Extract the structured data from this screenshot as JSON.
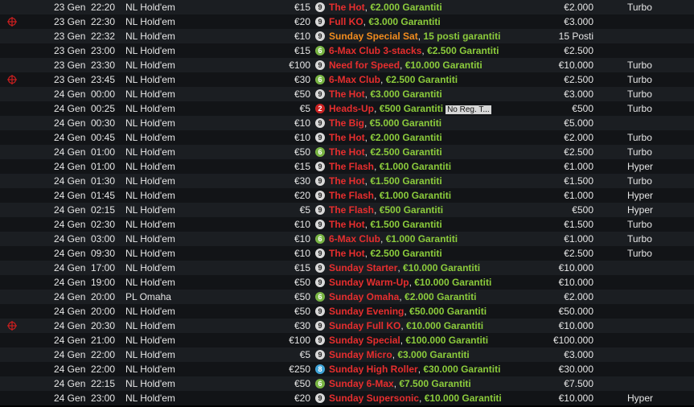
{
  "colors": {
    "title_red": "#e62e2e",
    "title_orange": "#f28c1e",
    "guarantee_green": "#8ccc3c",
    "row_odd": "#1b1e22",
    "row_even": "#121417",
    "mark_red": "#cc1f1f"
  },
  "rows": [
    {
      "mark": false,
      "date": "23 Gen",
      "time": "22:20",
      "game": "NL Hold'em",
      "buyin": "€15",
      "seats": "9",
      "title": "The Hot",
      "title_color": "red",
      "guarantee": "€2.000 Garantiti",
      "prize": "€2.000",
      "type": "Turbo"
    },
    {
      "mark": true,
      "date": "23 Gen",
      "time": "22:30",
      "game": "NL Hold'em",
      "buyin": "€20",
      "seats": "9",
      "title": "Full KO",
      "title_color": "red",
      "guarantee": "€3.000 Garantiti",
      "prize": "€3.000",
      "type": ""
    },
    {
      "mark": false,
      "date": "23 Gen",
      "time": "22:32",
      "game": "NL Hold'em",
      "buyin": "€10",
      "seats": "9",
      "title": "Sunday Special Sat",
      "title_color": "orange",
      "guarantee": "15 posti garantiti",
      "prize": "15 Posti",
      "type": ""
    },
    {
      "mark": false,
      "date": "23 Gen",
      "time": "23:00",
      "game": "NL Hold'em",
      "buyin": "€15",
      "seats": "6",
      "title": "6-Max Club 3-stacks",
      "title_color": "red",
      "guarantee": "€2.500 Garantiti",
      "prize": "€2.500",
      "type": ""
    },
    {
      "mark": false,
      "date": "23 Gen",
      "time": "23:30",
      "game": "NL Hold'em",
      "buyin": "€100",
      "seats": "9",
      "title": "Need for Speed",
      "title_color": "red",
      "guarantee": "€10.000 Garantiti",
      "prize": "€10.000",
      "type": "Turbo"
    },
    {
      "mark": true,
      "date": "23 Gen",
      "time": "23:45",
      "game": "NL Hold'em",
      "buyin": "€30",
      "seats": "6",
      "title": "6-Max Club",
      "title_color": "red",
      "guarantee": "€2.500 Garantiti",
      "prize": "€2.500",
      "type": "Turbo"
    },
    {
      "mark": false,
      "date": "24 Gen",
      "time": "00:00",
      "game": "NL Hold'em",
      "buyin": "€50",
      "seats": "9",
      "title": "The Hot",
      "title_color": "red",
      "guarantee": "€3.000 Garantiti",
      "prize": "€3.000",
      "type": "Turbo"
    },
    {
      "mark": false,
      "date": "24 Gen",
      "time": "00:25",
      "game": "NL Hold'em",
      "buyin": "€5",
      "seats": "2",
      "title": "Heads-Up",
      "title_color": "red",
      "guarantee": "€500 Garantiti",
      "note": "No Reg. T...",
      "prize": "€500",
      "type": "Turbo"
    },
    {
      "mark": false,
      "date": "24 Gen",
      "time": "00:30",
      "game": "NL Hold'em",
      "buyin": "€10",
      "seats": "9",
      "title": "The Big",
      "title_color": "red",
      "guarantee": "€5.000 Garantiti",
      "prize": "€5.000",
      "type": ""
    },
    {
      "mark": false,
      "date": "24 Gen",
      "time": "00:45",
      "game": "NL Hold'em",
      "buyin": "€10",
      "seats": "9",
      "title": "The Hot",
      "title_color": "red",
      "guarantee": "€2.000 Garantiti",
      "prize": "€2.000",
      "type": "Turbo"
    },
    {
      "mark": false,
      "date": "24 Gen",
      "time": "01:00",
      "game": "NL Hold'em",
      "buyin": "€50",
      "seats": "6",
      "title": "The Hot",
      "title_color": "red",
      "guarantee": "€2.500 Garantiti",
      "prize": "€2.500",
      "type": "Turbo"
    },
    {
      "mark": false,
      "date": "24 Gen",
      "time": "01:00",
      "game": "NL Hold'em",
      "buyin": "€15",
      "seats": "9",
      "title": "The Flash",
      "title_color": "red",
      "guarantee": "€1.000 Garantiti",
      "prize": "€1.000",
      "type": "Hyper"
    },
    {
      "mark": false,
      "date": "24 Gen",
      "time": "01:30",
      "game": "NL Hold'em",
      "buyin": "€30",
      "seats": "9",
      "title": "The Hot",
      "title_color": "red",
      "guarantee": "€1.500 Garantiti",
      "prize": "€1.500",
      "type": "Turbo"
    },
    {
      "mark": false,
      "date": "24 Gen",
      "time": "01:45",
      "game": "NL Hold'em",
      "buyin": "€20",
      "seats": "9",
      "title": "The Flash",
      "title_color": "red",
      "guarantee": "€1.000 Garantiti",
      "prize": "€1.000",
      "type": "Hyper"
    },
    {
      "mark": false,
      "date": "24 Gen",
      "time": "02:15",
      "game": "NL Hold'em",
      "buyin": "€5",
      "seats": "9",
      "title": "The Flash",
      "title_color": "red",
      "guarantee": "€500 Garantiti",
      "prize": "€500",
      "type": "Hyper"
    },
    {
      "mark": false,
      "date": "24 Gen",
      "time": "02:30",
      "game": "NL Hold'em",
      "buyin": "€10",
      "seats": "9",
      "title": "The Hot",
      "title_color": "red",
      "guarantee": "€1.500 Garantiti",
      "prize": "€1.500",
      "type": "Turbo"
    },
    {
      "mark": false,
      "date": "24 Gen",
      "time": "03:00",
      "game": "NL Hold'em",
      "buyin": "€10",
      "seats": "6",
      "title": "6-Max Club",
      "title_color": "red",
      "guarantee": "€1.000 Garantiti",
      "prize": "€1.000",
      "type": "Turbo"
    },
    {
      "mark": false,
      "date": "24 Gen",
      "time": "09:30",
      "game": "NL Hold'em",
      "buyin": "€10",
      "seats": "9",
      "title": "The Hot",
      "title_color": "red",
      "guarantee": "€2.500 Garantiti",
      "prize": "€2.500",
      "type": "Turbo"
    },
    {
      "mark": false,
      "date": "24 Gen",
      "time": "17:00",
      "game": "NL Hold'em",
      "buyin": "€15",
      "seats": "9",
      "title": "Sunday Starter",
      "title_color": "red",
      "guarantee": "€10.000 Garantiti",
      "prize": "€10.000",
      "type": ""
    },
    {
      "mark": false,
      "date": "24 Gen",
      "time": "19:00",
      "game": "NL Hold'em",
      "buyin": "€50",
      "seats": "9",
      "title": "Sunday Warm-Up",
      "title_color": "red",
      "guarantee": "€10.000 Garantiti",
      "prize": "€10.000",
      "type": ""
    },
    {
      "mark": false,
      "date": "24 Gen",
      "time": "20:00",
      "game": "PL Omaha",
      "buyin": "€50",
      "seats": "6",
      "title": "Sunday Omaha",
      "title_color": "red",
      "guarantee": "€2.000 Garantiti",
      "prize": "€2.000",
      "type": ""
    },
    {
      "mark": false,
      "date": "24 Gen",
      "time": "20:00",
      "game": "NL Hold'em",
      "buyin": "€50",
      "seats": "9",
      "title": "Sunday Evening",
      "title_color": "red",
      "guarantee": "€50.000 Garantiti",
      "prize": "€50.000",
      "type": ""
    },
    {
      "mark": true,
      "date": "24 Gen",
      "time": "20:30",
      "game": "NL Hold'em",
      "buyin": "€30",
      "seats": "9",
      "title": "Sunday Full KO",
      "title_color": "red",
      "guarantee": "€10.000 Garantiti",
      "prize": "€10.000",
      "type": ""
    },
    {
      "mark": false,
      "date": "24 Gen",
      "time": "21:00",
      "game": "NL Hold'em",
      "buyin": "€100",
      "seats": "9",
      "title": "Sunday Special",
      "title_color": "red",
      "guarantee": "€100.000 Garantiti",
      "prize": "€100.000",
      "type": ""
    },
    {
      "mark": false,
      "date": "24 Gen",
      "time": "22:00",
      "game": "NL Hold'em",
      "buyin": "€5",
      "seats": "9",
      "title": "Sunday Micro",
      "title_color": "red",
      "guarantee": "€3.000 Garantiti",
      "prize": "€3.000",
      "type": ""
    },
    {
      "mark": false,
      "date": "24 Gen",
      "time": "22:00",
      "game": "NL Hold'em",
      "buyin": "€250",
      "seats": "8",
      "title": "Sunday High Roller",
      "title_color": "red",
      "guarantee": "€30.000 Garantiti",
      "prize": "€30.000",
      "type": ""
    },
    {
      "mark": false,
      "date": "24 Gen",
      "time": "22:15",
      "game": "NL Hold'em",
      "buyin": "€50",
      "seats": "6",
      "title": "Sunday 6-Max",
      "title_color": "red",
      "guarantee": "€7.500 Garantiti",
      "prize": "€7.500",
      "type": ""
    },
    {
      "mark": false,
      "date": "24 Gen",
      "time": "23:00",
      "game": "NL Hold'em",
      "buyin": "€20",
      "seats": "9",
      "title": "Sunday Supersonic",
      "title_color": "red",
      "guarantee": "€10.000 Garantiti",
      "prize": "€10.000",
      "type": "Hyper"
    }
  ]
}
